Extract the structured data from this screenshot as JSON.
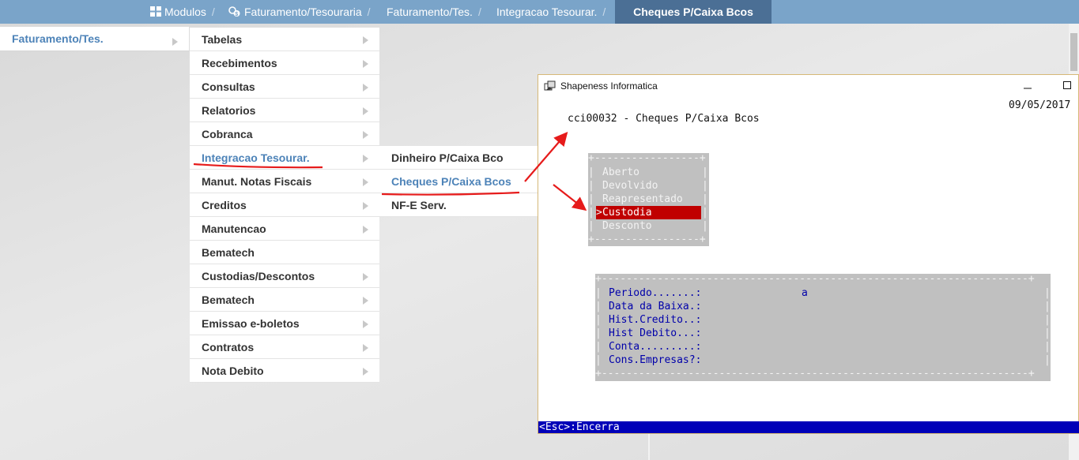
{
  "breadcrumb": [
    {
      "label": "Modulos",
      "icon": "grid-icon"
    },
    {
      "label": "Faturamento/Tesouraria",
      "icon": "coins-icon"
    },
    {
      "label": "Faturamento/Tes."
    },
    {
      "label": "Integracao Tesourar."
    },
    {
      "label": "Cheques P/Caixa Bcos"
    }
  ],
  "breadcrumb_separator": "/",
  "menu1": {
    "label": "Faturamento/Tes."
  },
  "menu2": [
    {
      "label": "Tabelas",
      "has_sub": true
    },
    {
      "label": "Recebimentos",
      "has_sub": true
    },
    {
      "label": "Consultas",
      "has_sub": true
    },
    {
      "label": "Relatorios",
      "has_sub": true
    },
    {
      "label": "Cobranca",
      "has_sub": true
    },
    {
      "label": "Integracao Tesourar.",
      "has_sub": true,
      "selected": true
    },
    {
      "label": "Manut. Notas Fiscais",
      "has_sub": true
    },
    {
      "label": "Creditos",
      "has_sub": true
    },
    {
      "label": "Manutencao",
      "has_sub": true
    },
    {
      "label": "Bematech",
      "has_sub": false
    },
    {
      "label": "Custodias/Descontos",
      "has_sub": true
    },
    {
      "label": "Bematech",
      "has_sub": true
    },
    {
      "label": "Emissao e-boletos",
      "has_sub": true
    },
    {
      "label": "Contratos",
      "has_sub": true
    },
    {
      "label": "Nota Debito",
      "has_sub": true
    }
  ],
  "menu3": [
    {
      "label": "Dinheiro P/Caixa Bco"
    },
    {
      "label": "Cheques P/Caixa Bcos",
      "selected": true
    },
    {
      "label": "NF-E Serv."
    }
  ],
  "window": {
    "title": "Shapeness Informatica",
    "date": "09/05/2017",
    "program": "cci00032 - Cheques P/Caixa Bcos",
    "options": [
      "Aberto",
      "Devolvido",
      "Reapresentado",
      "Custodia",
      "Desconto"
    ],
    "selected_option": "Custodia",
    "selection_marker": ">",
    "form_rows": [
      {
        "label": "Periodo.......:",
        "value": "a"
      },
      {
        "label": "Data da Baixa.:",
        "value": ""
      },
      {
        "label": "Hist.Credito..:",
        "value": ""
      },
      {
        "label": "Hist Debito...:",
        "value": ""
      },
      {
        "label": "Conta.........:",
        "value": ""
      },
      {
        "label": "Cons.Empresas?:",
        "value": ""
      }
    ],
    "status": "<Esc>:Encerra"
  },
  "colors": {
    "topbar": "#7aa4c9",
    "topbar_active": "#4b6f95",
    "link": "#4d83b8",
    "highlight": "#c00000",
    "status_bar": "#0000b8",
    "form_text": "#0000aa",
    "annotation": "#e61b1b"
  }
}
